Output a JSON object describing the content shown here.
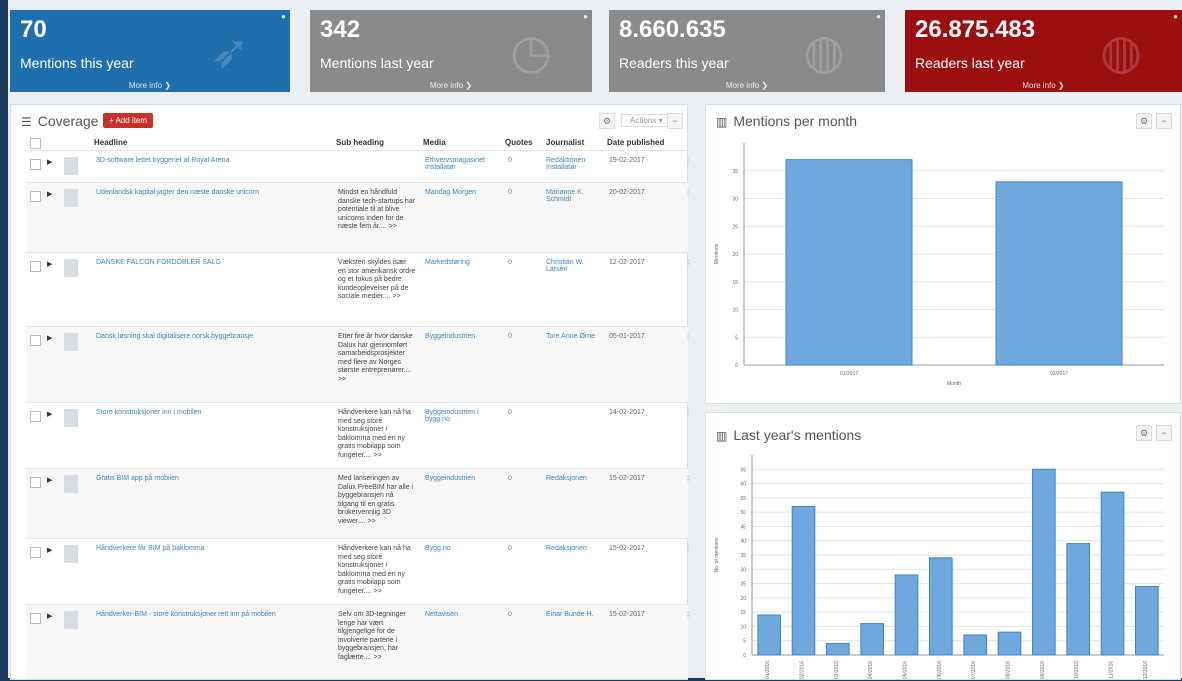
{
  "kpis": [
    {
      "value": "70",
      "label": "Mentions this year",
      "more": "More info",
      "color": "#1f6fae",
      "icon": "rocket-icon"
    },
    {
      "value": "342",
      "label": "Mentions last year",
      "more": "More info",
      "color": "#8a8a8a",
      "icon": "clock-icon"
    },
    {
      "value": "8.660.635",
      "label": "Readers this year",
      "more": "More info",
      "color": "#8a8a8a",
      "icon": "globe-icon"
    },
    {
      "value": "26.875.483",
      "label": "Readers last year",
      "more": "More info",
      "color": "#9b0f0f",
      "icon": "globe-icon"
    }
  ],
  "coverage": {
    "title": "Coverage",
    "add_label": "+ Add item",
    "actions_label": "Actions ▾",
    "columns": [
      "Headline",
      "Sub heading",
      "Media",
      "Quotes",
      "Journalist",
      "Date published"
    ],
    "rows": [
      {
        "headline": "3D-software lettet byggeriet af Royal Arena",
        "sub": "",
        "media": "Erhvervsmagasinet Installatør",
        "quotes": "0",
        "journalist": "Redaktionen Installatør",
        "date": "19-02-2017"
      },
      {
        "headline": "Udenlandsk kapital jagter den næste danske unicorn",
        "sub": "Mindst en håndfuld danske tech-startups har potentiale til at blive unicorns inden for de næste fem år.... >>",
        "media": "Mandag Morgen",
        "quotes": "0",
        "journalist": "Marianne K. Schmidt",
        "date": "20-02-2017"
      },
      {
        "headline": "DANSKE FALCON FORDOBLER SALG",
        "sub": "Væksten skyldes især en stor amerikansk ordre og et fokus på bedre kundeoplevelser på de sociale medier.... >>",
        "media": "Markedsføring",
        "quotes": "0",
        "journalist": "Christian W. Larsen",
        "date": "12-02-2017"
      },
      {
        "headline": "Dansk løsning skal digitalisere norsk byggebransje",
        "sub": "Etter fire år hvor danske Dalux har gjennomført samarbeidsprosjekter med flere av Norges største entreprenører.... >>",
        "media": "Byggeindustrien",
        "quotes": "0",
        "journalist": "Tore Anne Ørne",
        "date": "05-01-2017"
      },
      {
        "headline": "Store konstruksjoner inn i mobilen",
        "sub": "Håndverkere kan nå ha med seg store konstruksjoner i baklomma med en ny gratis mobilapp som fungerer.... >>",
        "media": "Byggeindustrien i bygg.no",
        "quotes": "0",
        "journalist": "",
        "date": "14-02-2017"
      },
      {
        "headline": "Gratis BIM app på mobilen",
        "sub": "Med lanseringen av Dalux FreeBIM har alle i byggebransjen nå tilgang til en gratis brukervennlig 3D viewer.... >>",
        "media": "Byggeindustrien",
        "quotes": "0",
        "journalist": "Redaksjonen",
        "date": "15-02-2017"
      },
      {
        "headline": "Håndverkere får BIM på baklomma",
        "sub": "Håndverkere kan nå ha med seg store konstruksjoner i baklomma med en ny gratis mobilapp som fungerer.... >>",
        "media": "Bygg.no",
        "quotes": "0",
        "journalist": "Redaksjonen",
        "date": "15-02-2017"
      },
      {
        "headline": "Håndverker-BIM - store konstruksjoner rett inn på mobilen",
        "sub": "Selv om 3D-tegninger lenge har vært tilgjengelige for de involverte partene i byggebransjen, har faglærte.... >>",
        "media": "Nettavisen",
        "quotes": "0",
        "journalist": "Einar Bunde H.",
        "date": "15-02-2017"
      }
    ]
  },
  "mentions_chart": {
    "title": "Mentions per month",
    "chart_data": {
      "type": "bar",
      "categories": [
        "01/2017",
        "02/2017"
      ],
      "values": [
        37,
        33
      ],
      "xlabel": "Month",
      "ylabel": "Mentions",
      "ylim": [
        0,
        40
      ],
      "yticks": [
        0,
        5,
        10,
        15,
        20,
        25,
        30,
        35
      ],
      "color": "#6fa8dc"
    }
  },
  "lastyear_chart": {
    "title": "Last year's mentions",
    "chart_data": {
      "type": "bar",
      "categories": [
        "01/2016",
        "02/2016",
        "03/2016",
        "04/2016",
        "05/2016",
        "06/2016",
        "07/2016",
        "08/2016",
        "09/2016",
        "10/2016",
        "11/2016",
        "12/2016"
      ],
      "values": [
        14,
        52,
        4,
        11,
        28,
        34,
        7,
        8,
        65,
        39,
        57,
        24
      ],
      "ylabel": "No. of mentions",
      "ylim": [
        0,
        70
      ],
      "yticks": [
        0,
        5,
        10,
        15,
        20,
        25,
        30,
        35,
        40,
        45,
        50,
        55,
        60,
        65
      ],
      "color": "#6fa8dc"
    }
  }
}
